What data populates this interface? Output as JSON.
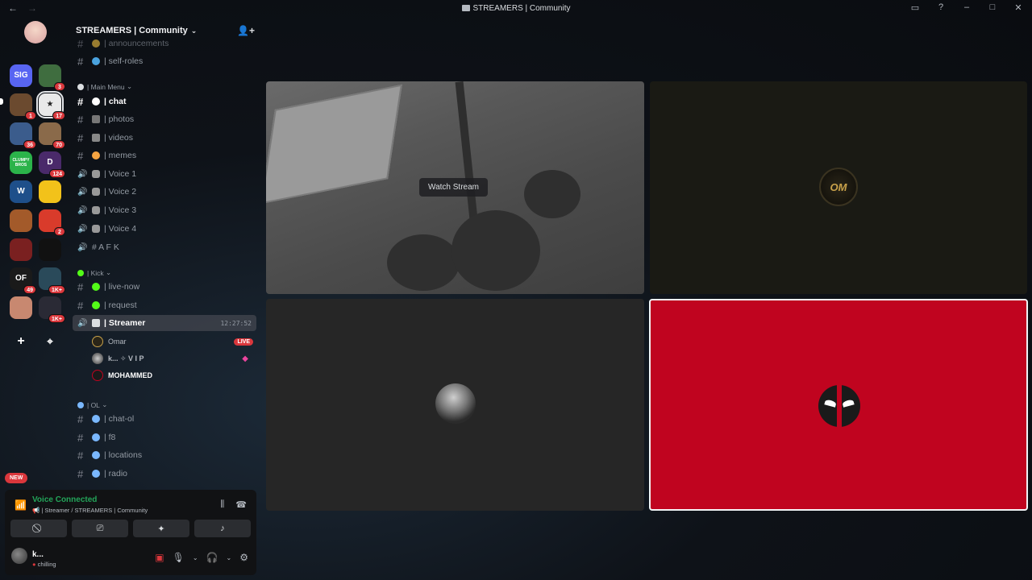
{
  "titlebar": {
    "title": "STREAMERS | Community",
    "back": "←",
    "forward": "→"
  },
  "servers": [
    {
      "id": "acronym",
      "label": "SIG",
      "badge": "",
      "color": "#5865f2"
    },
    {
      "id": "s2",
      "label": "",
      "badge": "3",
      "color": "#3f6d3f"
    },
    {
      "id": "s3",
      "label": "",
      "badge": "1",
      "color": "#6b4a2f"
    },
    {
      "id": "s4",
      "label": "★",
      "badge": "17",
      "color": "#e9e9e9"
    },
    {
      "id": "s5",
      "label": "",
      "badge": "36",
      "color": "#3b5c8c"
    },
    {
      "id": "s6",
      "label": "",
      "badge": "70",
      "color": "#8a6a4a"
    },
    {
      "id": "s7",
      "label": "CLUMPY BROS",
      "badge": "",
      "color": "#2bb34a"
    },
    {
      "id": "s8",
      "label": "D",
      "badge": "124",
      "color": "#4a2a6a"
    },
    {
      "id": "s9",
      "label": "W",
      "badge": "",
      "color": "#1e4f8a"
    },
    {
      "id": "s10",
      "label": "",
      "badge": "",
      "color": "#f2c21a"
    },
    {
      "id": "s11",
      "label": "",
      "badge": "",
      "color": "#a35a2a"
    },
    {
      "id": "s12",
      "label": "",
      "badge": "2",
      "color": "#d93b2b"
    },
    {
      "id": "s13",
      "label": "",
      "badge": "",
      "color": "#7a2020"
    },
    {
      "id": "s14",
      "label": "",
      "badge": "",
      "color": "#111111"
    },
    {
      "id": "s15",
      "label": "OF",
      "badge": "49",
      "color": "#1a1a1a"
    },
    {
      "id": "s16",
      "label": "",
      "badge": "1K+",
      "color": "#2a4a5a"
    },
    {
      "id": "s17",
      "label": "",
      "badge": "",
      "color": "#c88870"
    },
    {
      "id": "s18",
      "label": "",
      "badge": "1K+",
      "color": "#2a2a35"
    }
  ],
  "server_actions": {
    "add": "+",
    "discover": "⌖"
  },
  "guild": {
    "name": "STREAMERS | Community",
    "chevron": "⌄",
    "invite": "👤+"
  },
  "channels": {
    "announcements": "| announcements",
    "self_roles": "| self-roles",
    "cat_main": "| Main Menu",
    "chat": "| chat",
    "photos": "| photos",
    "videos": "| videos",
    "memes": "| memes",
    "voice1": "| Voice 1",
    "voice2": "| Voice 2",
    "voice3": "| Voice 3",
    "voice4": "| Voice 4",
    "afk": "# A F K",
    "cat_kick": "| Kick",
    "live_now": "| live-now",
    "request": "| request",
    "streamer": "| Streamer",
    "streamer_time": "12:27:52",
    "cat_ol": "| OL",
    "chat_ol": "| chat-ol",
    "f8": "| f8",
    "locations": "| locations",
    "radio": "| radio"
  },
  "voice_users": [
    {
      "name": "Omar",
      "live": "LIVE"
    },
    {
      "name": "k... ✧ V I P",
      "live": ""
    },
    {
      "name": "MOHAMMED",
      "live": ""
    }
  ],
  "new_badge": "NEW",
  "voice_panel": {
    "status": "Voice Connected",
    "channel": "📢 | Streamer / STREAMERS | Community"
  },
  "user": {
    "name": "k...",
    "status": "chilling"
  },
  "stream": {
    "watch_label": "Watch Stream",
    "om_initials": "OM"
  },
  "colors": {
    "accent": "#5865f2",
    "live": "#da373c",
    "connected": "#23a55a",
    "deadpool": "#c0041f"
  }
}
